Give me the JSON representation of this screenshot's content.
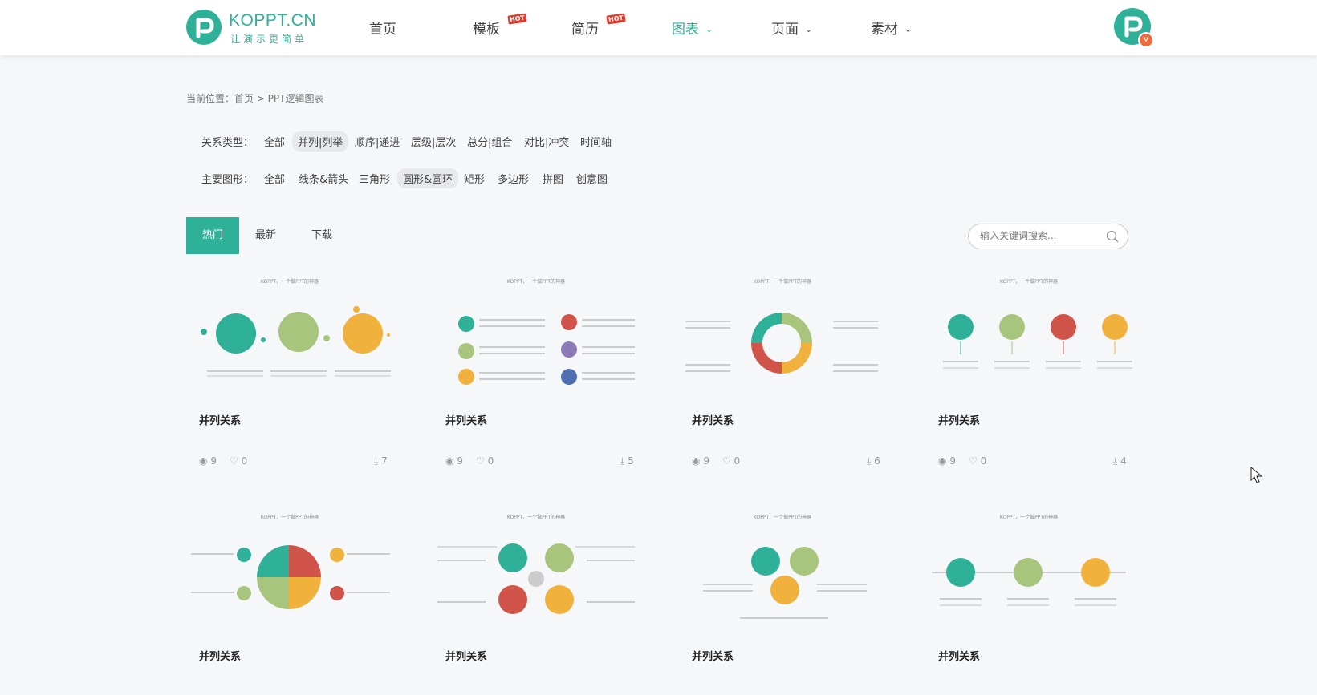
{
  "brand": {
    "name": "KOPPT.CN",
    "slogan": "让演示更简单"
  },
  "nav": [
    {
      "label": "首页",
      "badge": ""
    },
    {
      "label": "模板",
      "badge": "HOT"
    },
    {
      "label": "简历",
      "badge": "HOT"
    },
    {
      "label": "图表",
      "badge": "",
      "dropdown": true,
      "active": true
    },
    {
      "label": "页面",
      "badge": "",
      "dropdown": true
    },
    {
      "label": "素材",
      "badge": "",
      "dropdown": true
    }
  ],
  "breadcrumb": "当前位置：首页 > PPT逻辑图表",
  "filters": {
    "relation": {
      "label": "关系类型：",
      "options": [
        "全部",
        "并列|列举",
        "顺序|递进",
        "层级|层次",
        "总分|组合",
        "对比|冲突",
        "时间轴"
      ],
      "selected": "并列|列举"
    },
    "shape": {
      "label": "主要图形：",
      "options": [
        "全部",
        "线条&箭头",
        "三角形",
        "圆形&圆环",
        "矩形",
        "多边形",
        "拼图",
        "创意图"
      ],
      "selected": "圆形&圆环"
    }
  },
  "tabs": [
    "热门",
    "最新",
    "下载"
  ],
  "activeTab": "热门",
  "search": {
    "placeholder": "输入关键词搜索..."
  },
  "cards": [
    {
      "thumbTitle": "KOPPT，一个做PPT的神器",
      "title": "并列关系",
      "views": "9",
      "likes": "0",
      "downloads": "7"
    },
    {
      "thumbTitle": "KOPPT，一个做PPT的神器",
      "title": "并列关系",
      "views": "9",
      "likes": "0",
      "downloads": "5"
    },
    {
      "thumbTitle": "KOPPT，一个做PPT的神器",
      "title": "并列关系",
      "views": "9",
      "likes": "0",
      "downloads": "6"
    },
    {
      "thumbTitle": "KOPPT，一个做PPT的神器",
      "title": "并列关系",
      "views": "9",
      "likes": "0",
      "downloads": "4"
    },
    {
      "thumbTitle": "KOPPT，一个做PPT的神器",
      "title": "并列关系",
      "views": "",
      "likes": "",
      "downloads": ""
    },
    {
      "thumbTitle": "KOPPT，一个做PPT的神器",
      "title": "并列关系",
      "views": "",
      "likes": "",
      "downloads": ""
    },
    {
      "thumbTitle": "KOPPT，一个做PPT的神器",
      "title": "并列关系",
      "views": "",
      "likes": "",
      "downloads": ""
    },
    {
      "thumbTitle": "KOPPT，一个做PPT的神器",
      "title": "并列关系",
      "views": "",
      "likes": "",
      "downloads": ""
    }
  ],
  "colors": {
    "accent": "#2fb098",
    "green": "#a7c57c",
    "yellow": "#f1b13d",
    "red": "#d1544a",
    "purple": "#8b79b8",
    "blue": "#4f6fb2"
  }
}
